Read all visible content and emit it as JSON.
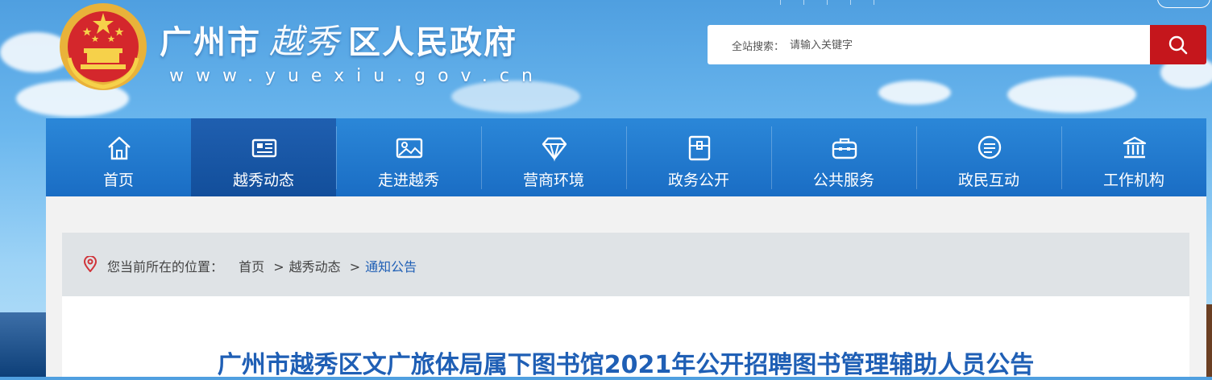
{
  "header": {
    "title_prefix": "广州市",
    "title_calligraphy": "越秀",
    "title_suffix": "区人民政府",
    "url": "www.yuexiu.gov.cn"
  },
  "search": {
    "label": "全站搜索：",
    "placeholder": "请输入关键字"
  },
  "nav": {
    "items": [
      {
        "label": "首页",
        "icon": "home-icon"
      },
      {
        "label": "越秀动态",
        "icon": "newspaper-icon"
      },
      {
        "label": "走进越秀",
        "icon": "picture-icon"
      },
      {
        "label": "营商环境",
        "icon": "diamond-icon"
      },
      {
        "label": "政务公开",
        "icon": "folder-icon"
      },
      {
        "label": "公共服务",
        "icon": "briefcase-icon"
      },
      {
        "label": "政民互动",
        "icon": "chat-icon"
      },
      {
        "label": "工作机构",
        "icon": "building-icon"
      }
    ],
    "active_index": 1
  },
  "breadcrumb": {
    "prefix": "您当前所在的位置：",
    "items": [
      "首页",
      "越秀动态",
      "通知公告"
    ],
    "separator": ">"
  },
  "article": {
    "title": "广州市越秀区文广旅体局属下图书馆2021年公开招聘图书管理辅助人员公告"
  },
  "colors": {
    "nav": "#1a6dc4",
    "nav_active": "#114d99",
    "search_button": "#c5161c",
    "title": "#1f5fb5"
  }
}
